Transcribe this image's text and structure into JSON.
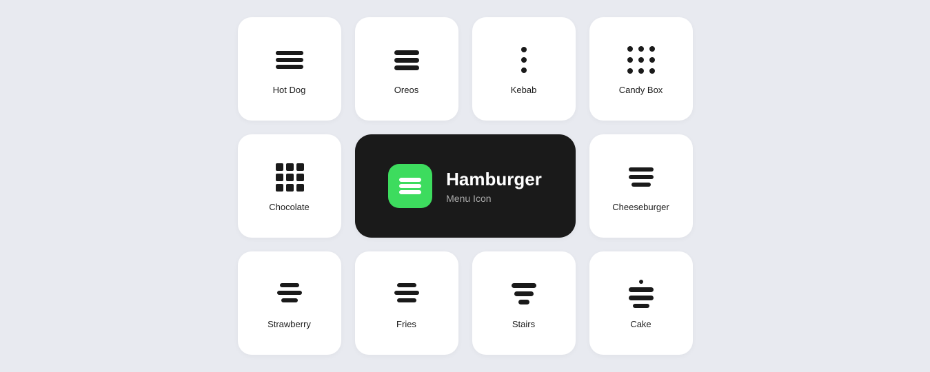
{
  "cards": [
    {
      "id": "hot-dog",
      "label": "Hot Dog",
      "icon": "hot-dog-icon",
      "featured": false
    },
    {
      "id": "oreos",
      "label": "Oreos",
      "icon": "oreos-icon",
      "featured": false
    },
    {
      "id": "kebab",
      "label": "Kebab",
      "icon": "kebab-icon",
      "featured": false
    },
    {
      "id": "candy-box",
      "label": "Candy Box",
      "icon": "candy-box-icon",
      "featured": false
    },
    {
      "id": "chocolate",
      "label": "Chocolate",
      "icon": "chocolate-icon",
      "featured": false
    },
    {
      "id": "hamburger",
      "label": "Hamburger",
      "subtitle": "Menu Icon",
      "icon": "hamburger-icon",
      "featured": true
    },
    {
      "id": "cheeseburger",
      "label": "Cheeseburger",
      "icon": "cheeseburger-icon",
      "featured": false
    },
    {
      "id": "strawberry",
      "label": "Strawberry",
      "icon": "strawberry-icon",
      "featured": false
    },
    {
      "id": "fries",
      "label": "Fries",
      "icon": "fries-icon",
      "featured": false
    },
    {
      "id": "stairs",
      "label": "Stairs",
      "icon": "stairs-icon",
      "featured": false
    },
    {
      "id": "cake",
      "label": "Cake",
      "icon": "cake-icon",
      "featured": false
    }
  ],
  "featured": {
    "title": "Hamburger",
    "subtitle": "Menu Icon"
  }
}
